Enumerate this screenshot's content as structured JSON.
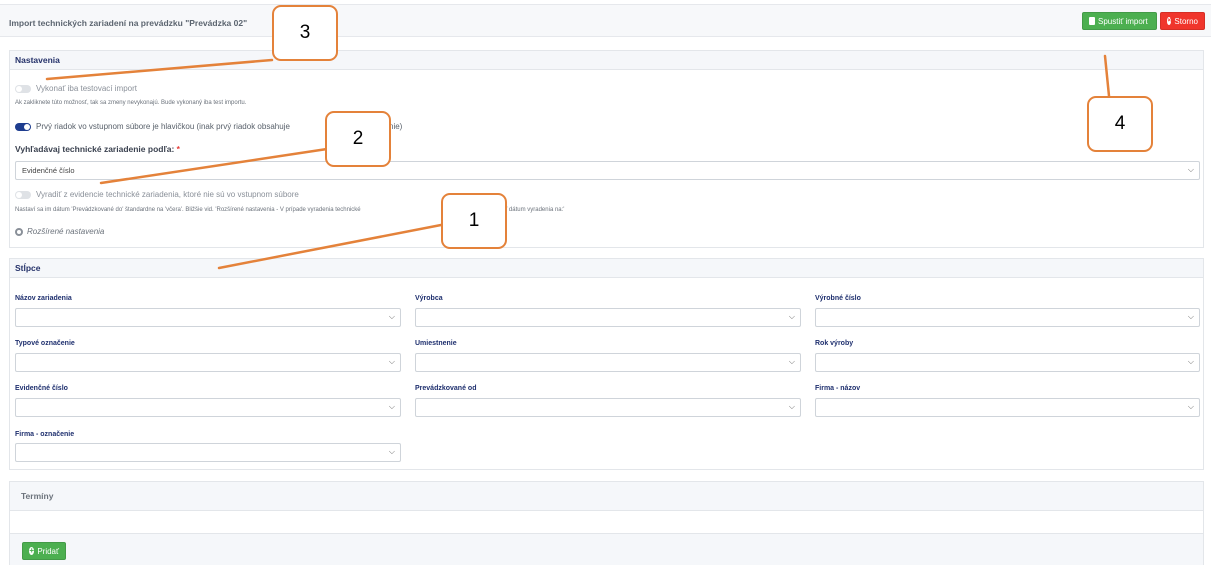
{
  "header": {
    "title": "Import technických zariadení na prevádzku \"Prevádzka 02\"",
    "start_label": "Spustiť import",
    "cancel_label": "Storno"
  },
  "settings": {
    "title": "Nastavenia",
    "test_import": {
      "label": "Vykonať iba testovací import",
      "hint": "Ak zakliknete túto možnosť, tak sa zmeny nevykonajú. Bude vykonaný iba test importu.",
      "enabled": false
    },
    "header_row": {
      "label": "Prvý riadok vo vstupnom súbore je hlavičkou (inak prvý riadok obsahuje",
      "label_tail": "nie)",
      "enabled": true
    },
    "search_by": {
      "label": "Vyhľadávaj technické zariadenie podľa:",
      "required_mark": "*",
      "value": "Evidenčné číslo"
    },
    "decommission": {
      "label": "Vyradiť z evidencie technické zariadenia, ktoré nie sú vo vstupnom súbore",
      "hint": "Nastaví sa im dátum 'Prevádzkované do' štandardne na 'včera'. Bližšie vid. 'Rozšírené nastavenia - V prípade vyradenia technické",
      "hint_tail": "ť dátum vyradenia na:'",
      "enabled": false
    },
    "advanced_label": "Rozšírené nastavenia"
  },
  "columns": {
    "title": "Stĺpce",
    "fields": [
      {
        "label": "Názov zariadenia",
        "value": ""
      },
      {
        "label": "Výrobca",
        "value": ""
      },
      {
        "label": "Výrobné číslo",
        "value": ""
      },
      {
        "label": "Typové označenie",
        "value": ""
      },
      {
        "label": "Umiestnenie",
        "value": ""
      },
      {
        "label": "Rok výroby",
        "value": ""
      },
      {
        "label": "Evidenčné číslo",
        "value": ""
      },
      {
        "label": "Prevádzkované od",
        "value": ""
      },
      {
        "label": "Firma - názov",
        "value": ""
      },
      {
        "label": "Firma - označenie",
        "value": ""
      }
    ]
  },
  "terms": {
    "title": "Termíny",
    "add_label": "Pridať"
  },
  "annotations": {
    "callouts": [
      "3",
      "2",
      "1",
      "4"
    ],
    "color": "#e4823a"
  },
  "icons": {
    "start": "file-icon",
    "cancel": "close-circle-icon",
    "add": "plus-circle-icon",
    "advanced": "gears-icon",
    "select": "chevron-down-icon"
  }
}
